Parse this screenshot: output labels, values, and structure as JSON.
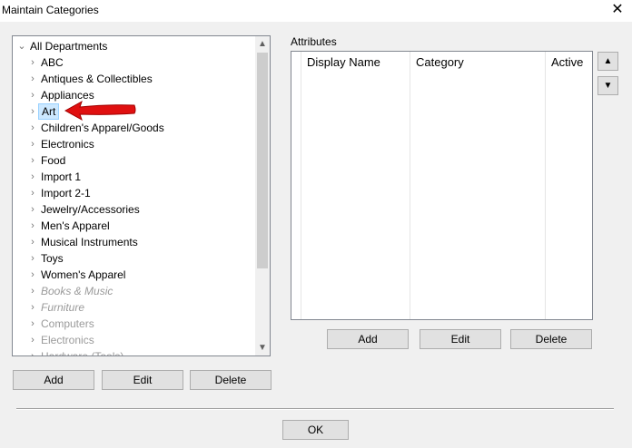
{
  "window": {
    "title": "Maintain Categories",
    "close_symbol": "✕"
  },
  "tree": {
    "root": "All Departments",
    "items": [
      {
        "label": "ABC",
        "style": "normal"
      },
      {
        "label": "Antiques & Collectibles",
        "style": "normal"
      },
      {
        "label": "Appliances",
        "style": "normal"
      },
      {
        "label": "Art",
        "style": "selected"
      },
      {
        "label": "Children's Apparel/Goods",
        "style": "normal"
      },
      {
        "label": "Electronics",
        "style": "normal"
      },
      {
        "label": "Food",
        "style": "normal"
      },
      {
        "label": "Import 1",
        "style": "normal"
      },
      {
        "label": "Import 2-1",
        "style": "normal"
      },
      {
        "label": "Jewelry/Accessories",
        "style": "normal"
      },
      {
        "label": "Men's Apparel",
        "style": "normal"
      },
      {
        "label": "Musical Instruments",
        "style": "normal"
      },
      {
        "label": "Toys",
        "style": "normal"
      },
      {
        "label": "Women's Apparel",
        "style": "normal"
      },
      {
        "label": "Books & Music",
        "style": "italic-disabled"
      },
      {
        "label": "Furniture",
        "style": "italic-disabled"
      },
      {
        "label": "Computers",
        "style": "disabled"
      },
      {
        "label": "Electronics",
        "style": "disabled"
      },
      {
        "label": "Hardware (Tools)",
        "style": "disabled"
      }
    ],
    "buttons": {
      "add": "Add",
      "edit": "Edit",
      "delete": "Delete"
    }
  },
  "attributes": {
    "label": "Attributes",
    "columns": [
      "Display Name",
      "Category",
      "Active"
    ],
    "buttons": {
      "add": "Add",
      "edit": "Edit",
      "delete": "Delete"
    }
  },
  "footer": {
    "ok": "OK"
  },
  "colors": {
    "arrow": "#e01010",
    "selection": "#cce8ff"
  }
}
